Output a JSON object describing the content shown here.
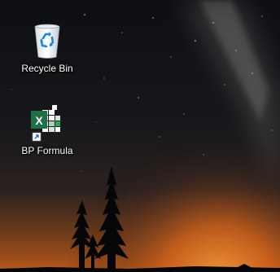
{
  "desktop": {
    "icons": [
      {
        "label": "Recycle Bin",
        "icon": "recycle-bin-icon"
      },
      {
        "label": "BP Formula",
        "icon": "excel-shortcut-icon"
      }
    ]
  },
  "colors": {
    "sky_top": "#0d0f14",
    "sky_mid": "#1c1a1c",
    "horizon_glow": "#e0701a",
    "excel_green": "#1e7145",
    "label_text": "#ffffff"
  }
}
